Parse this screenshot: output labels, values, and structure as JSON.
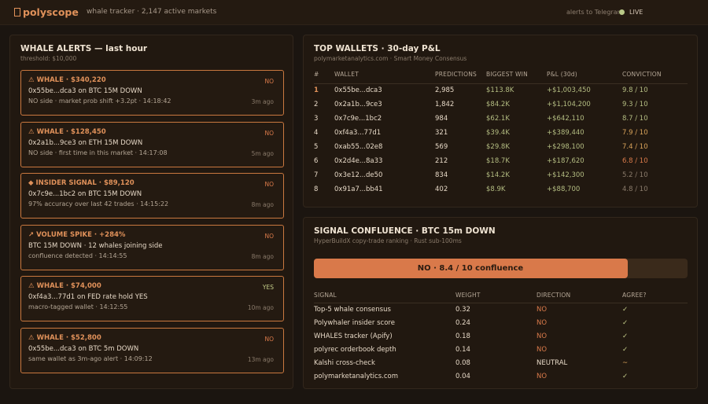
{
  "topbar": {
    "logo_glyph": "▯",
    "logo": "polyscope",
    "subtitle": "whale tracker · 2,147 active markets",
    "alerts_label": "alerts to Telegram",
    "live_label": "LIVE",
    "live_color": "#b9c987"
  },
  "whale_alerts": {
    "title": "WHALE ALERTS — last hour",
    "threshold": "threshold: $10,000",
    "items": [
      {
        "head": "⚠ WHALE · $340,220",
        "side": "NO",
        "line1": "0x55be...dca3 on BTC 15M DOWN",
        "line2": "NO side · market prob shift +3.2pt · 14:18:42",
        "ago": "3m ago"
      },
      {
        "head": "⚠ WHALE · $128,450",
        "side": "NO",
        "line1": "0x2a1b...9ce3 on ETH 15M DOWN",
        "line2": "NO side · first time in this market · 14:17:08",
        "ago": "5m ago"
      },
      {
        "head": "◆ INSIDER SIGNAL · $89,120",
        "side": "NO",
        "line1": "0x7c9e...1bc2 on BTC 15M DOWN",
        "line2": "97% accuracy over last 42 trades · 14:15:22",
        "ago": "8m ago"
      },
      {
        "head": "↗ VOLUME SPIKE · +284%",
        "side": "NO",
        "line1": "BTC 15M DOWN · 12 whales joining side",
        "line2": "confluence detected · 14:14:55",
        "ago": "8m ago"
      },
      {
        "head": "⚠ WHALE · $74,000",
        "side": "YES",
        "line1": "0xf4a3...77d1 on FED rate hold YES",
        "line2": "macro-tagged wallet · 14:12:55",
        "ago": "10m ago"
      },
      {
        "head": "⚠ WHALE · $52,800",
        "side": "NO",
        "line1": "0x55be...dca3 on BTC 5m DOWN",
        "line2": "same wallet as 3m-ago alert · 14:09:12",
        "ago": "13m ago"
      }
    ]
  },
  "top_wallets": {
    "title": "TOP WALLETS · 30-day P&L",
    "subtitle": "polymarketanalytics.com · Smart Money Consensus",
    "columns": [
      "#",
      "WALLET",
      "PREDICTIONS",
      "BIGGEST WIN",
      "P&L (30d)",
      "CONVICTION"
    ],
    "rows": [
      {
        "rank": "1",
        "wallet": "0x55be...dca3",
        "predictions": "2,985",
        "biggest_win": "$113.8K",
        "pnl": "+$1,003,450",
        "conviction": "9.8 / 10",
        "conviction_color": "#b4bd82"
      },
      {
        "rank": "2",
        "wallet": "0x2a1b...9ce3",
        "predictions": "1,842",
        "biggest_win": "$84.2K",
        "pnl": "+$1,104,200",
        "conviction": "9.3 / 10",
        "conviction_color": "#b4bd82"
      },
      {
        "rank": "3",
        "wallet": "0x7c9e...1bc2",
        "predictions": "984",
        "biggest_win": "$62.1K",
        "pnl": "+$642,110",
        "conviction": "8.7 / 10",
        "conviction_color": "#b4bd82"
      },
      {
        "rank": "4",
        "wallet": "0xf4a3...77d1",
        "predictions": "321",
        "biggest_win": "$39.4K",
        "pnl": "+$389,440",
        "conviction": "7.9 / 10",
        "conviction_color": "#d9a35a"
      },
      {
        "rank": "5",
        "wallet": "0xab55...02e8",
        "predictions": "569",
        "biggest_win": "$29.8K",
        "pnl": "+$298,100",
        "conviction": "7.4 / 10",
        "conviction_color": "#d9a35a"
      },
      {
        "rank": "6",
        "wallet": "0x2d4e...8a33",
        "predictions": "212",
        "biggest_win": "$18.7K",
        "pnl": "+$187,620",
        "conviction": "6.8 / 10",
        "conviction_color": "#d97a4a"
      },
      {
        "rank": "7",
        "wallet": "0x3e12...de50",
        "predictions": "834",
        "biggest_win": "$14.2K",
        "pnl": "+$142,300",
        "conviction": "5.2 / 10",
        "conviction_color": "#8a7b6b"
      },
      {
        "rank": "8",
        "wallet": "0x91a7...bb41",
        "predictions": "402",
        "biggest_win": "$8.9K",
        "pnl": "+$88,700",
        "conviction": "4.8 / 10",
        "conviction_color": "#8a7b6b"
      }
    ]
  },
  "confluence": {
    "title": "SIGNAL CONFLUENCE · BTC 15m DOWN",
    "subtitle": "HyperBuildX copy-trade ranking · Rust sub-100ms",
    "bar_label": "NO · 8.4 / 10 confluence",
    "bar_value": 8.4,
    "bar_max": 10,
    "columns": [
      "SIGNAL",
      "WEIGHT",
      "DIRECTION",
      "AGREE?"
    ],
    "rows": [
      {
        "signal": "Top-5 whale consensus",
        "weight": "0.32",
        "direction": "NO",
        "agree": "✓"
      },
      {
        "signal": "Polywhaler insider score",
        "weight": "0.24",
        "direction": "NO",
        "agree": "✓"
      },
      {
        "signal": "WHALES tracker (Apify)",
        "weight": "0.18",
        "direction": "NO",
        "agree": "✓"
      },
      {
        "signal": "polyrec orderbook depth",
        "weight": "0.14",
        "direction": "NO",
        "agree": "✓"
      },
      {
        "signal": "Kalshi cross-check",
        "weight": "0.08",
        "direction": "NEUTRAL",
        "agree": "~"
      },
      {
        "signal": "polymarketanalytics.com",
        "weight": "0.04",
        "direction": "NO",
        "agree": "✓"
      }
    ]
  }
}
